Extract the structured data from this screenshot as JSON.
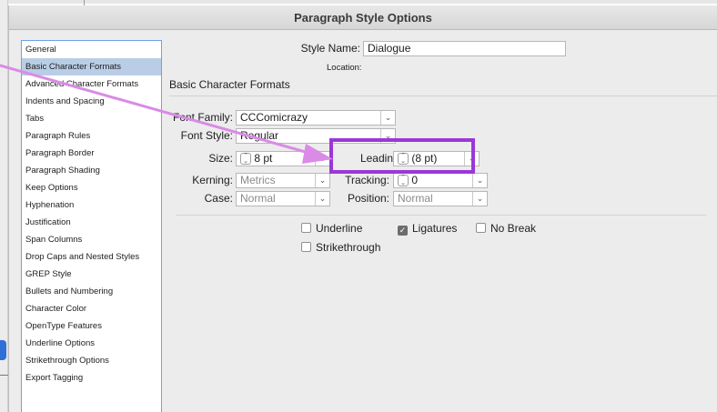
{
  "dialog": {
    "title": "Paragraph Style Options"
  },
  "style_name": {
    "label": "Style Name:",
    "value": "Dialogue"
  },
  "location": {
    "label": "Location:"
  },
  "section_title": "Basic Character Formats",
  "sidebar": {
    "items": [
      {
        "label": "General"
      },
      {
        "label": "Basic Character Formats",
        "active": true
      },
      {
        "label": "Advanced Character Formats"
      },
      {
        "label": "Indents and Spacing"
      },
      {
        "label": "Tabs"
      },
      {
        "label": "Paragraph Rules"
      },
      {
        "label": "Paragraph Border"
      },
      {
        "label": "Paragraph Shading"
      },
      {
        "label": "Keep Options"
      },
      {
        "label": "Hyphenation"
      },
      {
        "label": "Justification"
      },
      {
        "label": "Span Columns"
      },
      {
        "label": "Drop Caps and Nested Styles"
      },
      {
        "label": "GREP Style"
      },
      {
        "label": "Bullets and Numbering"
      },
      {
        "label": "Character Color"
      },
      {
        "label": "OpenType Features"
      },
      {
        "label": "Underline Options"
      },
      {
        "label": "Strikethrough Options"
      },
      {
        "label": "Export Tagging"
      }
    ]
  },
  "fields": {
    "font_family": {
      "label": "Font Family:",
      "value": "CCComicrazy"
    },
    "font_style": {
      "label": "Font Style:",
      "value": "Regular"
    },
    "size": {
      "label": "Size:",
      "value": "8 pt"
    },
    "leading": {
      "label": "Leading:",
      "value": "(8 pt)"
    },
    "kerning": {
      "label": "Kerning:",
      "value": "Metrics"
    },
    "tracking": {
      "label": "Tracking:",
      "value": "0"
    },
    "case": {
      "label": "Case:",
      "value": "Normal"
    },
    "position": {
      "label": "Position:",
      "value": "Normal"
    }
  },
  "checkboxes": {
    "underline": {
      "label": "Underline",
      "checked": false
    },
    "ligatures": {
      "label": "Ligatures",
      "checked": true
    },
    "no_break": {
      "label": "No Break",
      "checked": false
    },
    "strikethrough": {
      "label": "Strikethrough",
      "checked": false
    }
  },
  "colors": {
    "annotation": "#9b37d8",
    "arrow": "#d98be6",
    "selection": "#b9cde6",
    "sidebar_border": "#6ea1e8"
  },
  "icons": {
    "dropdown": "chevron-down-icon",
    "stepper": "stepper-icon",
    "check": "checkmark-icon"
  }
}
